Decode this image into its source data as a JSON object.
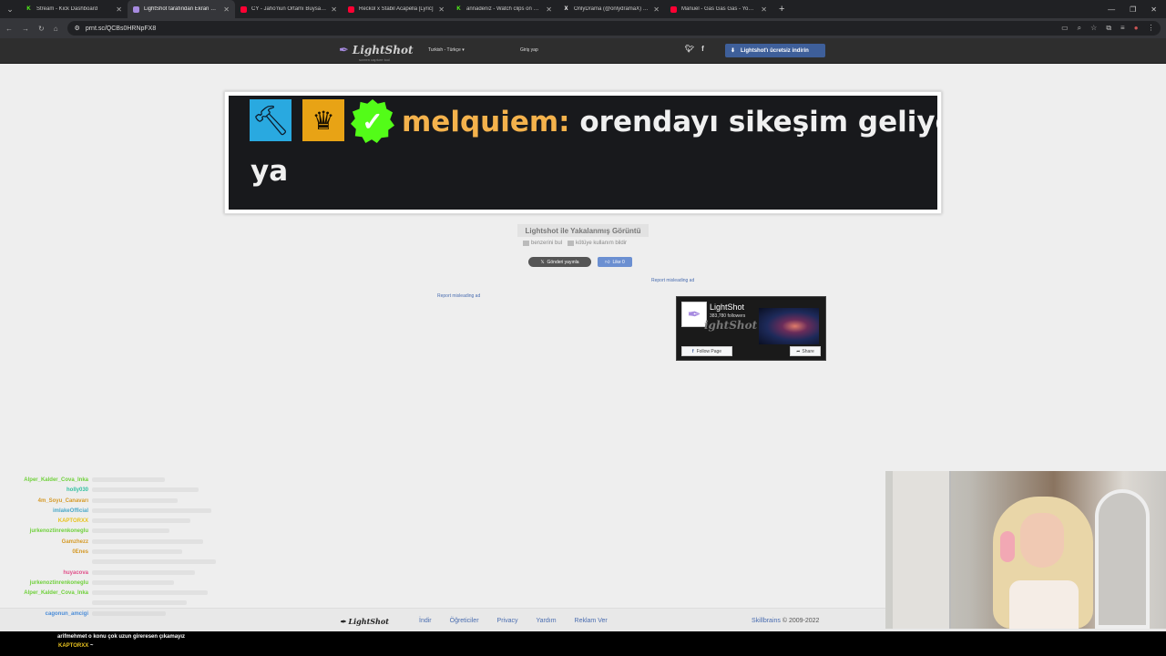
{
  "browser": {
    "tabs": [
      {
        "title": "Stream - Kick Dashboard",
        "fav": "K",
        "color": "#53fc18",
        "active": false
      },
      {
        "title": "LightShot tarafından Ekran Gör",
        "fav": "",
        "color": "#a78be0",
        "active": true
      },
      {
        "title": "CY - Jaho'nun Ortamı Buysa Be",
        "fav": "",
        "color": "#ff0033",
        "active": false
      },
      {
        "title": "Reckol x Stabil Acapella [Lyric]",
        "fav": "",
        "color": "#ff0033",
        "active": false
      },
      {
        "title": "annadeniz - Watch clips on Kick",
        "fav": "K",
        "color": "#53fc18",
        "active": false
      },
      {
        "title": "OnlyDrama (@onlydramaX) / X",
        "fav": "X",
        "color": "#ffffff",
        "active": false
      },
      {
        "title": "Manuel - Gas Gas Gas - YouTub",
        "fav": "",
        "color": "#ff0033",
        "active": false
      }
    ],
    "url": "prnt.sc/QCBs0HRNpFX8"
  },
  "header": {
    "logo": "LightShot",
    "logo_sub": "screen capture tool",
    "language": "Turkish - Türkçe",
    "login": "Giriş yap",
    "download": "Lightshot'ı ücretsiz indirin"
  },
  "screenshot": {
    "username": "melquiem:",
    "message_line1": "orendayı sikeşim geliyor",
    "message_line2": "ya"
  },
  "caption": {
    "title": "Lightshot ile Yakalanmış Görüntü",
    "similar": "benzerini bul",
    "report": "kötüye kullanım bildir",
    "tweet": "Gönderi yayınla",
    "like": "Like 0",
    "report_ad_1": "Report misleading ad",
    "report_ad_2": "Report misleading ad"
  },
  "fb": {
    "page": "LightShot",
    "followers": "383,780 followers",
    "follow": "Follow Page",
    "share": "Share"
  },
  "footer": {
    "logo": "LightShot",
    "links": [
      "İndir",
      "Öğreticiler",
      "Privacy",
      "Yardım",
      "Reklam Ver"
    ],
    "company": "Skillbrains",
    "copyright": "© 2009-2022"
  },
  "chat": [
    {
      "user": "Alper_Kalder_Cova_Inka",
      "color": "#6fd03a"
    },
    {
      "user": "holly030",
      "color": "#35c0a0"
    },
    {
      "user": "4m_Soyu_Canavarı",
      "color": "#d59a28"
    },
    {
      "user": "imlakeOfficial",
      "color": "#4aa8c8"
    },
    {
      "user": "KAPTORXX",
      "color": "#e8c21f"
    },
    {
      "user": "jurkenoztinrenkoneglu",
      "color": "#6fd03a"
    },
    {
      "user": "Gamzhezz",
      "color": "#d59a28"
    },
    {
      "user": "0Enes",
      "color": "#d59a28"
    },
    {
      "user": "",
      "color": "#d59a28"
    },
    {
      "user": "huyacova",
      "color": "#e0508a"
    },
    {
      "user": "jurkenoztinrenkoneglu",
      "color": "#6fd03a"
    },
    {
      "user": "Alper_Kalder_Cova_Inka",
      "color": "#6fd03a"
    },
    {
      "user": "",
      "color": "#6fd03a"
    },
    {
      "user": "cagonun_amcigi",
      "color": "#4a8cd8"
    }
  ],
  "chat_bottom": {
    "user1": "arifmehmet",
    "msg1": "o konu çok uzun gireresen çıkamayız",
    "user2": "KAPTORXX",
    "msg2": "~"
  }
}
